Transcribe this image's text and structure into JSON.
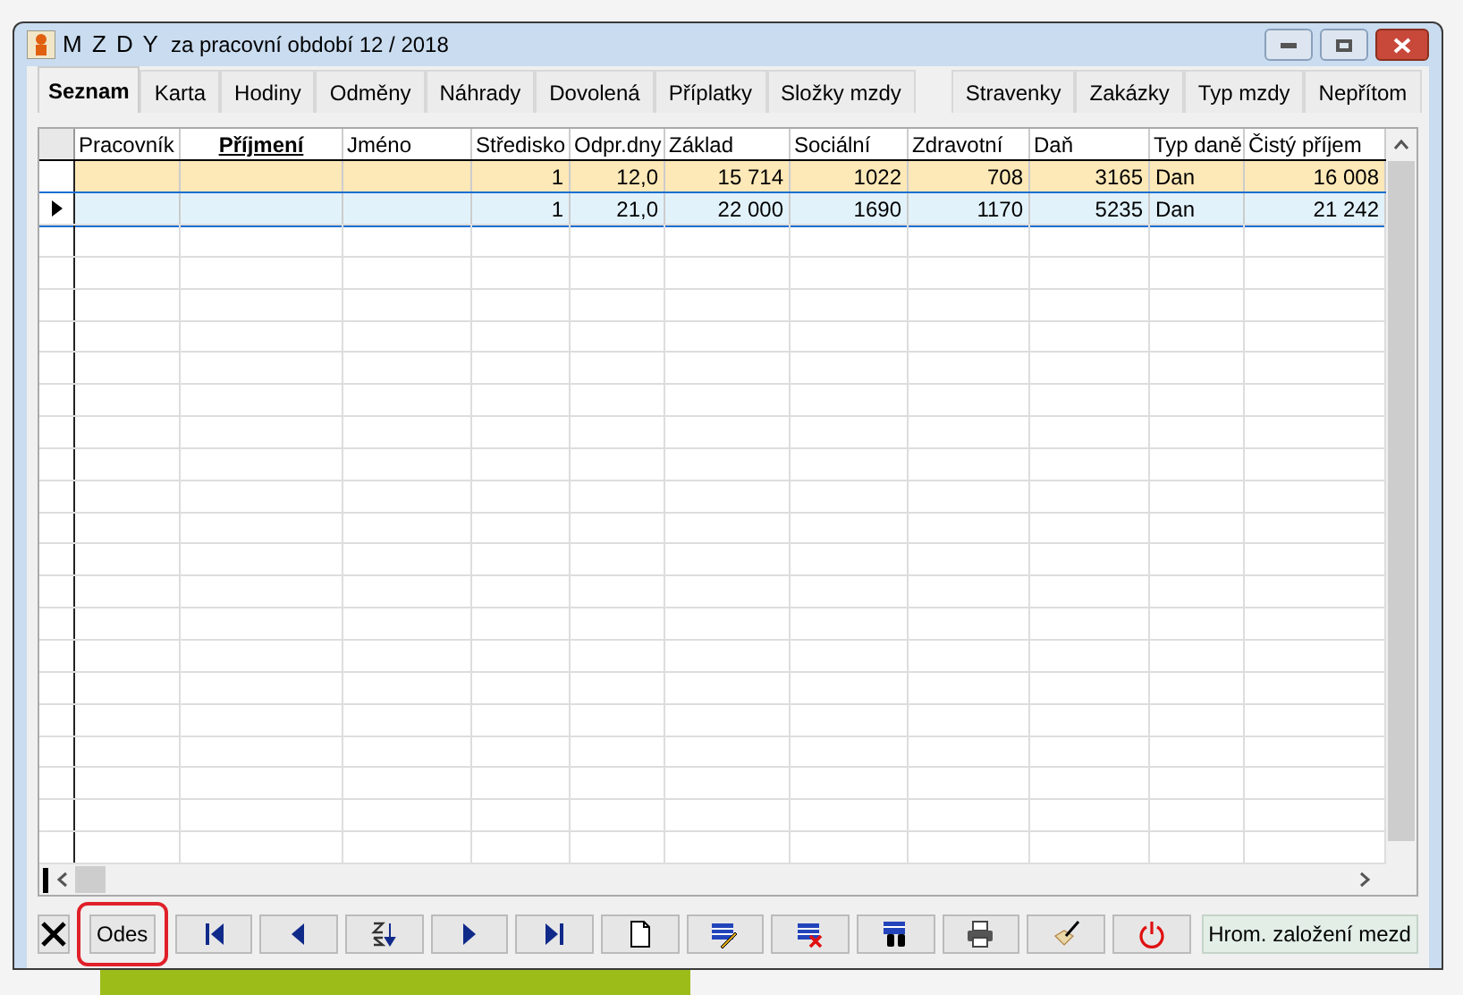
{
  "window": {
    "title": "M Z D Y",
    "subtitle": "za pracovní období 12 / 2018"
  },
  "tabs": [
    {
      "label": "Seznam",
      "selected": true
    },
    {
      "label": "Karta",
      "selected": false
    },
    {
      "label": "Hodiny",
      "selected": false
    },
    {
      "label": "Odměny",
      "selected": false
    },
    {
      "label": "Náhrady",
      "selected": false
    },
    {
      "label": "Dovolená",
      "selected": false
    },
    {
      "label": "Příplatky",
      "selected": false
    },
    {
      "label": "Složky mzdy",
      "selected": false
    },
    {
      "label": "Stravenky",
      "selected": false
    },
    {
      "label": "Zakázky",
      "selected": false
    },
    {
      "label": "Typ mzdy",
      "selected": false
    },
    {
      "label": "Nepřítom",
      "selected": false
    }
  ],
  "table": {
    "columns": [
      {
        "label": "Pracovník",
        "sorted": false
      },
      {
        "label": "Příjmení",
        "sorted": true
      },
      {
        "label": "Jméno",
        "sorted": false
      },
      {
        "label": "Středisko",
        "sorted": false
      },
      {
        "label": "Odpr.dny",
        "sorted": false
      },
      {
        "label": "Základ",
        "sorted": false
      },
      {
        "label": "Sociální",
        "sorted": false
      },
      {
        "label": "Zdravotní",
        "sorted": false
      },
      {
        "label": "Daň",
        "sorted": false
      },
      {
        "label": "Typ daně",
        "sorted": false
      },
      {
        "label": "Čistý příjem",
        "sorted": false
      }
    ],
    "rows": [
      {
        "selected": false,
        "highlighted": true,
        "cells": {
          "stredisko": "1",
          "dny": "12,0",
          "zaklad": "15 714",
          "socialni": "1022",
          "zdravotni": "708",
          "dan": "3165",
          "typ": "Dan",
          "cisty": "16 008"
        }
      },
      {
        "selected": true,
        "highlighted": false,
        "cells": {
          "stredisko": "1",
          "dny": "21,0",
          "zaklad": "22 000",
          "socialni": "1690",
          "zdravotni": "1170",
          "dan": "5235",
          "typ": "Dan",
          "cisty": "21 242"
        }
      }
    ]
  },
  "toolbar": [
    {
      "kind": "cancel"
    },
    {
      "kind": "text",
      "label": "Odes",
      "marked": true
    },
    {
      "kind": "first"
    },
    {
      "kind": "prev"
    },
    {
      "kind": "sort"
    },
    {
      "kind": "next"
    },
    {
      "kind": "last"
    },
    {
      "kind": "new"
    },
    {
      "kind": "edit"
    },
    {
      "kind": "delete"
    },
    {
      "kind": "find"
    },
    {
      "kind": "print"
    },
    {
      "kind": "tool"
    },
    {
      "kind": "power"
    },
    {
      "kind": "wide",
      "label": "Hrom. založení mezd"
    }
  ]
}
